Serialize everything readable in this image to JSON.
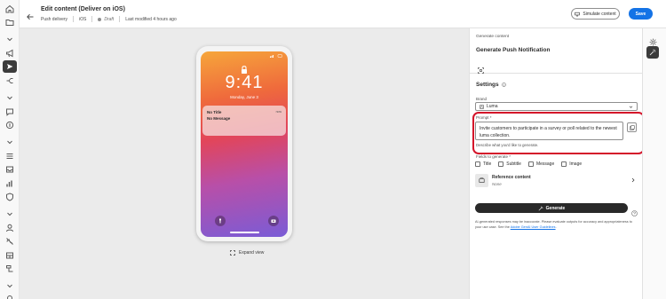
{
  "header": {
    "title": "Edit content (Deliver on iOS)",
    "meta": {
      "channel": "Push delivery",
      "platform": "iOS",
      "status": "Draft",
      "modified": "Last modified 4 hours ago"
    },
    "simulate_label": "Simulate content",
    "save_label": "Save"
  },
  "preview": {
    "time": "9:41",
    "date": "Monday, June 3",
    "notification": {
      "title": "No Title",
      "message": "No Message",
      "when": "now"
    },
    "expand_label": "Expand view"
  },
  "panel": {
    "section_label": "Generate content",
    "title": "Generate Push Notification",
    "settings_label": "Settings",
    "brand": {
      "label": "Brand",
      "value": "Luma"
    },
    "prompt": {
      "label": "Prompt",
      "required_mark": "*",
      "value": "Invite customers to participate in a survey or poll related to the newest luma collection.",
      "help": "Describe what you'd like to generate."
    },
    "fields_label": "Fields to generate *",
    "checkboxes": [
      {
        "label": "Title",
        "checked": false
      },
      {
        "label": "Subtitle",
        "checked": false
      },
      {
        "label": "Message",
        "checked": false
      },
      {
        "label": "Image",
        "checked": false
      }
    ],
    "reference": {
      "title": "Reference content",
      "value": "None"
    },
    "generate_label": "Generate",
    "disclaimer_prefix": "AI-generated responses may be inaccurate. Please evaluate outputs for accuracy and appropriateness to your use case. See the ",
    "disclaimer_link": "Adobe GenAI User Guidelines",
    "disclaimer_suffix": "."
  },
  "colors": {
    "accent": "#1473e6",
    "highlight": "#d4142a",
    "primary_dark": "#292929"
  },
  "icons": {
    "rail": [
      "home-icon",
      "folder-icon",
      "chevron-down-icon",
      "megaphone-icon",
      "send-icon",
      "journey-icon",
      "chevron-down-icon",
      "message-icon",
      "offers-icon",
      "chevron-down-icon",
      "list-icon",
      "inbox-icon",
      "chart-icon",
      "shield-icon",
      "chevron-down-icon",
      "user-icon",
      "audience-icon",
      "segment-icon",
      "schema-icon",
      "chevron-down-icon",
      "settings-icon"
    ]
  }
}
